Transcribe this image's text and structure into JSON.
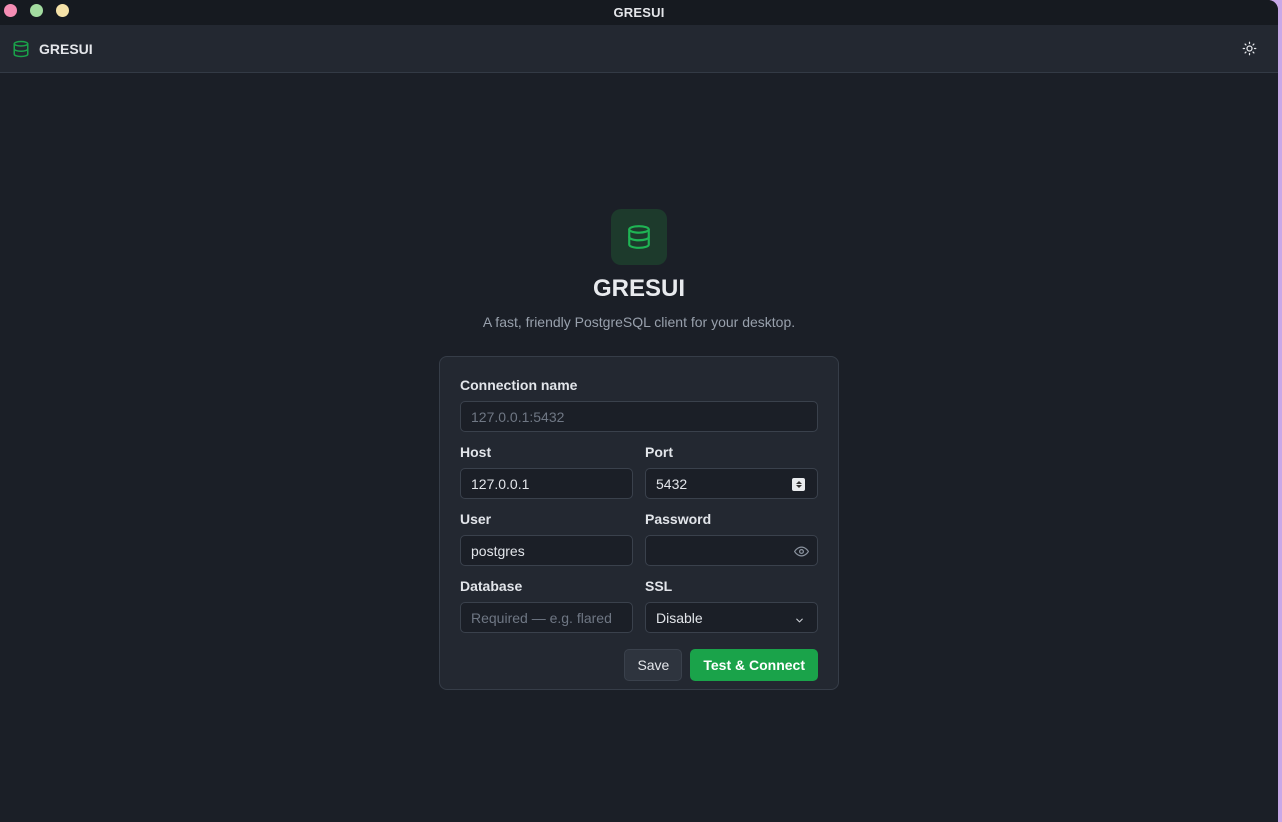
{
  "window": {
    "title": "GRESUI"
  },
  "appbar": {
    "brand": "GRESUI"
  },
  "hero": {
    "title": "GRESUI",
    "subtitle": "A fast, friendly PostgreSQL client for your desktop."
  },
  "form": {
    "connection_name": {
      "label": "Connection name",
      "value": "",
      "placeholder": "127.0.0.1:5432"
    },
    "host": {
      "label": "Host",
      "value": "127.0.0.1"
    },
    "port": {
      "label": "Port",
      "value": "5432"
    },
    "user": {
      "label": "User",
      "value": "postgres"
    },
    "password": {
      "label": "Password",
      "value": ""
    },
    "database": {
      "label": "Database",
      "value": "",
      "placeholder": "Required — e.g. flared"
    },
    "ssl": {
      "label": "SSL",
      "value": "Disable"
    },
    "save_label": "Save",
    "connect_label": "Test & Connect"
  },
  "colors": {
    "accent": "#1aa34a",
    "background": "#1b1f27",
    "card": "#232831"
  },
  "icons": {
    "brand": "database-icon",
    "theme": "sun-icon",
    "password_toggle": "eye-icon",
    "select": "chevron-down-icon"
  }
}
